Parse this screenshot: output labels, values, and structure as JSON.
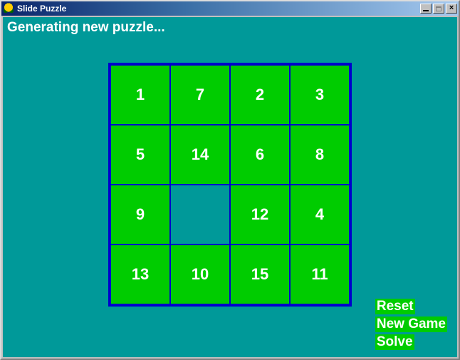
{
  "window": {
    "title": "Slide Puzzle"
  },
  "status": {
    "text": "Generating new puzzle..."
  },
  "board": {
    "size": 4,
    "tiles": [
      "1",
      "7",
      "2",
      "3",
      "5",
      "14",
      "6",
      "8",
      "9",
      "",
      "12",
      "4",
      "13",
      "10",
      "15",
      "11"
    ]
  },
  "menu": {
    "reset": "Reset",
    "new_game": "New Game",
    "solve": "Solve"
  }
}
